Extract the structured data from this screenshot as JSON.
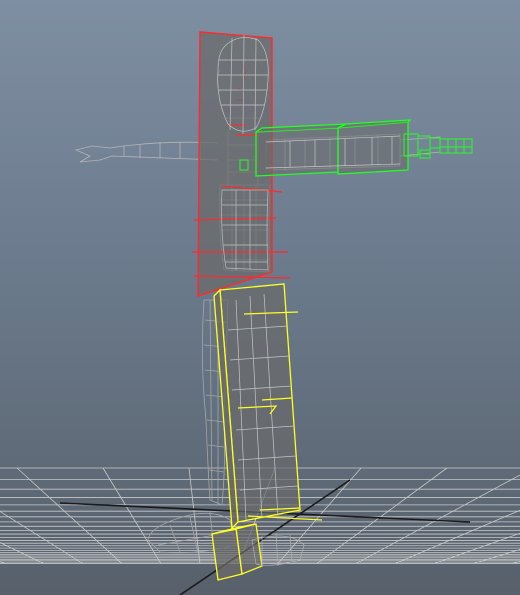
{
  "viewport": {
    "name": "perspective-viewport",
    "background_top": "#7f8fa2",
    "background_bottom": "#57606b"
  },
  "scene": {
    "grid_color": "#c9c9c9",
    "grid_axis_color": "#1a1a1a",
    "wireframe_color": "#a6a6a6",
    "proxy_fill": "#6a6a6a",
    "torso_proxy_color": "#ff2a2a",
    "arm_proxy_color": "#22ff22",
    "leg_proxy_color": "#ffff22"
  }
}
